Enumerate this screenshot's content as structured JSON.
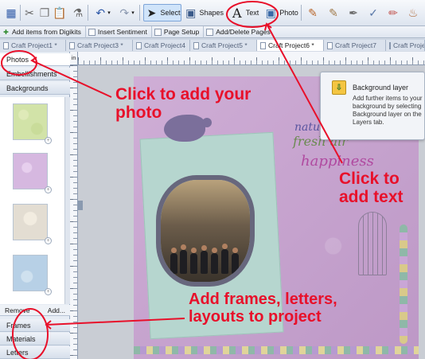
{
  "toolbar": {
    "buttons": [
      {
        "name": "save-icon"
      },
      {
        "name": "cut-icon"
      },
      {
        "name": "copy-icon"
      },
      {
        "name": "paste-icon"
      },
      {
        "name": "format-painter-icon"
      },
      {
        "name": "undo-icon"
      },
      {
        "name": "redo-icon"
      }
    ],
    "select_label": "Select",
    "shapes_label": "Shapes",
    "text_label": "Text",
    "photo_label": "Photo"
  },
  "subtoolbar": {
    "add_items_label": "Add items from Digikits",
    "insert_sentiment_label": "Insert Sentiment",
    "page_setup_label": "Page Setup",
    "add_delete_pages_label": "Add/Delete Pages"
  },
  "tabs": [
    {
      "label": "Craft Project1 *",
      "active": false
    },
    {
      "label": "Craft Project3 *",
      "active": false
    },
    {
      "label": "Craft Project4",
      "active": false
    },
    {
      "label": "Craft Project5 *",
      "active": false
    },
    {
      "label": "Craft Project6 *",
      "active": true
    },
    {
      "label": "Craft Project7",
      "active": false
    },
    {
      "label": "Craft Proje",
      "active": false
    }
  ],
  "left_panel": {
    "photos_label": "Photos",
    "embellishments_label": "Embellishments",
    "backgrounds_label": "Backgrounds",
    "remove_label": "Remove",
    "add_label": "Add...",
    "frames_label": "Frames",
    "materials_label": "Materials",
    "letters_label": "Letters"
  },
  "ruler": {
    "unit_label": "in"
  },
  "tooltip": {
    "title": "Background layer",
    "body": "Add further items to your background by selecting Background layer on the Layers tab."
  },
  "canvas_text": {
    "nature": "nature",
    "fresh_air": "fresh air",
    "happiness": "happiness"
  },
  "annotations": {
    "photo": "Click to add your\nphoto",
    "text": "Click to\nadd text",
    "frames": "Add frames, letters,\nlayouts to project"
  },
  "colors": {
    "annotation": "#e8102a",
    "paper": "#c8a7cf",
    "card": "#b6d6cf"
  }
}
